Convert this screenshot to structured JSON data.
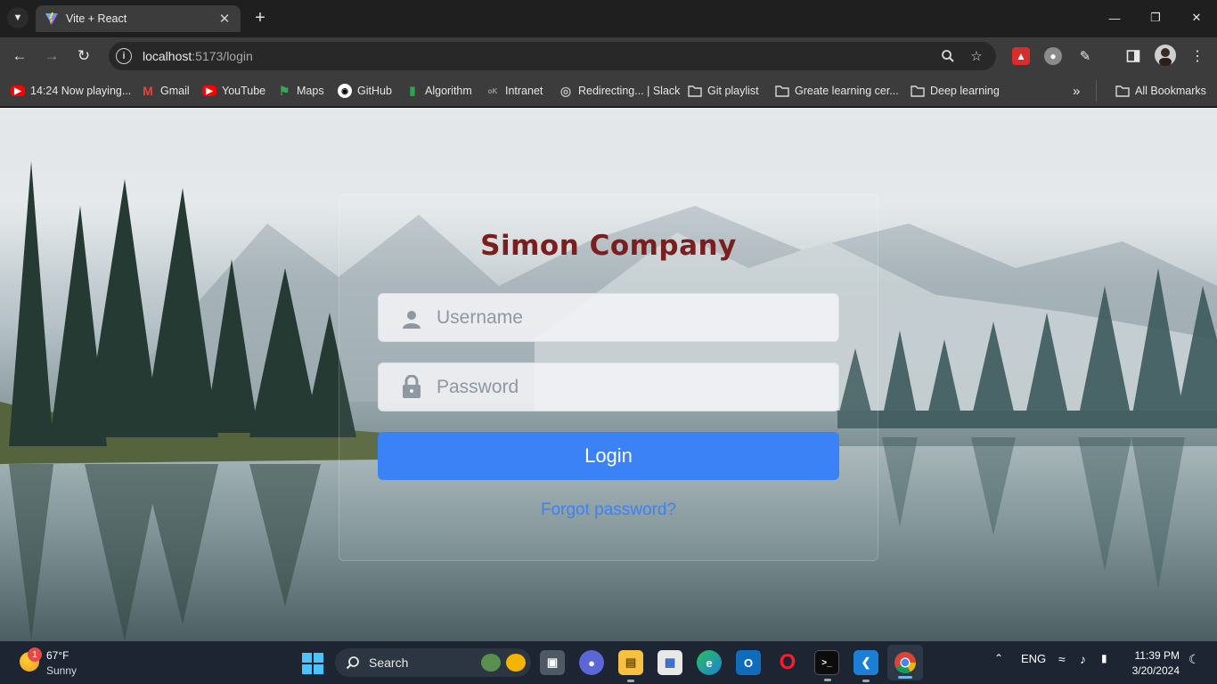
{
  "browser": {
    "tab": {
      "title": "Vite + React"
    },
    "url": {
      "host": "localhost",
      "path": ":5173/login"
    },
    "bookmarks": [
      {
        "label": "14:24 Now playing...",
        "icon": "youtube-icon"
      },
      {
        "label": "Gmail",
        "icon": "gmail-icon"
      },
      {
        "label": "YouTube",
        "icon": "youtube-icon"
      },
      {
        "label": "Maps",
        "icon": "maps-icon"
      },
      {
        "label": "GitHub",
        "icon": "github-icon"
      },
      {
        "label": "Algorithm",
        "icon": "algorithm-icon"
      },
      {
        "label": "Intranet",
        "icon": "intranet-icon"
      },
      {
        "label": "Redirecting... | Slack",
        "icon": "globe-icon"
      },
      {
        "label": "Git playlist",
        "icon": "folder-icon"
      },
      {
        "label": "Greate learning cer...",
        "icon": "folder-icon"
      },
      {
        "label": "Deep learning",
        "icon": "folder-icon"
      }
    ],
    "all_bookmarks": "All Bookmarks"
  },
  "login": {
    "company_name": "Simon Company",
    "username_placeholder": "Username",
    "password_placeholder": "Password",
    "login_label": "Login",
    "forgot_label": "Forgot password?"
  },
  "colors": {
    "company_title": "#7b1e1e",
    "button": "#3b82f6",
    "link": "#3b82f6"
  },
  "taskbar": {
    "weather": {
      "badge": "1",
      "temp": "67°F",
      "condition": "Sunny"
    },
    "search_label": "Search",
    "tray": {
      "language": "ENG"
    },
    "clock": {
      "time": "11:39 PM",
      "date": "3/20/2024"
    }
  }
}
